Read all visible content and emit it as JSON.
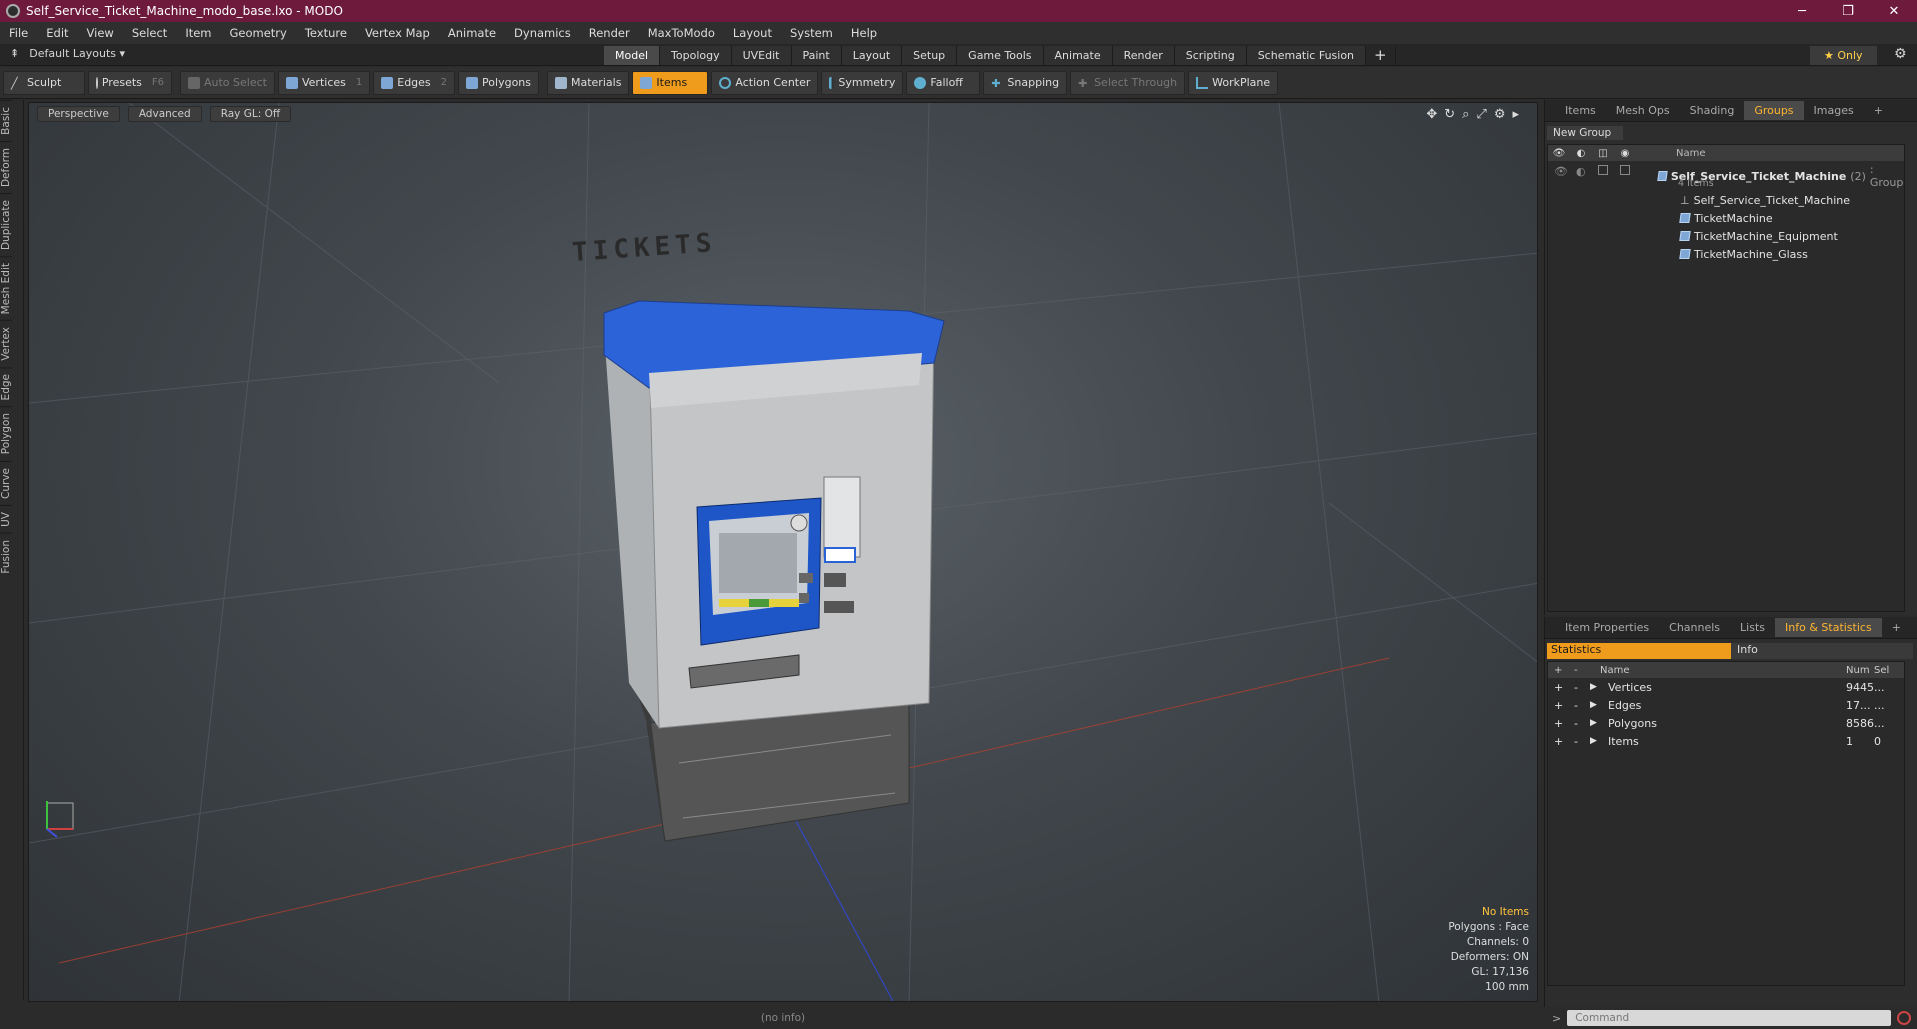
{
  "window": {
    "title": "Self_Service_Ticket_Machine_modo_base.lxo - MODO",
    "minimize": "─",
    "maximize": "❐",
    "close": "✕"
  },
  "menu": [
    "File",
    "Edit",
    "View",
    "Select",
    "Item",
    "Geometry",
    "Texture",
    "Vertex Map",
    "Animate",
    "Dynamics",
    "Render",
    "MaxToModo",
    "Layout",
    "System",
    "Help"
  ],
  "layouts": {
    "label": "Default Layouts ▾"
  },
  "mode_tabs": [
    "Model",
    "Topology",
    "UVEdit",
    "Paint",
    "Layout",
    "Setup",
    "Game Tools",
    "Animate",
    "Render",
    "Scripting",
    "Schematic Fusion"
  ],
  "mode_tabs_active": "Model",
  "only_button": "★ Only",
  "toolbar": {
    "sculpt": "Sculpt",
    "presets": "Presets",
    "presets_key": "F6",
    "auto_select": "Auto Select",
    "vertices": "Vertices",
    "vertices_key": "1",
    "edges": "Edges",
    "edges_key": "2",
    "polygons": "Polygons",
    "materials": "Materials",
    "items": "Items",
    "action_center": "Action Center",
    "symmetry": "Symmetry",
    "falloff": "Falloff",
    "snapping": "Snapping",
    "select_through": "Select Through",
    "workplane": "WorkPlane"
  },
  "left_tabs": [
    "Basic",
    "Deform",
    "Duplicate",
    "Mesh Edit",
    "Vertex",
    "Edge",
    "Polygon",
    "Curve",
    "UV",
    "Fusion"
  ],
  "viewport": {
    "view": "Perspective",
    "shading": "Advanced",
    "raygl": "Ray GL: Off",
    "model_text": "TICKETS",
    "info": {
      "no_items": "No Items",
      "polygons": "Polygons : Face",
      "channels": "Channels: 0",
      "deformers": "Deformers: ON",
      "gl": "GL: 17,136",
      "scale": "100 mm"
    }
  },
  "status": "(no info)",
  "groups_panel": {
    "tabs": [
      "Items",
      "Mesh Ops",
      "Shading",
      "Groups",
      "Images"
    ],
    "active": "Groups",
    "new_group": "New Group",
    "name_col": "Name",
    "group_name": "Self_Service_Ticket_Machine",
    "group_count": "(2)",
    "group_type": ": Group",
    "group_sub": "4 Items",
    "children": [
      "Self_Service_Ticket_Machine",
      "TicketMachine",
      "TicketMachine_Equipment",
      "TicketMachine_Glass"
    ]
  },
  "info_panel": {
    "tabs": [
      "Item Properties",
      "Channels",
      "Lists",
      "Info & Statistics"
    ],
    "active": "Info & Statistics",
    "stats_tab": "Statistics",
    "info_tab": "Info",
    "cols": {
      "name": "Name",
      "num": "Num",
      "sel": "Sel"
    },
    "rows": [
      {
        "name": "Vertices",
        "num": "9445",
        "sel": "..."
      },
      {
        "name": "Edges",
        "num": "17...",
        "sel": "..."
      },
      {
        "name": "Polygons",
        "num": "8586",
        "sel": "..."
      },
      {
        "name": "Items",
        "num": "1",
        "sel": "0"
      }
    ]
  },
  "command": {
    "placeholder": "Command"
  }
}
